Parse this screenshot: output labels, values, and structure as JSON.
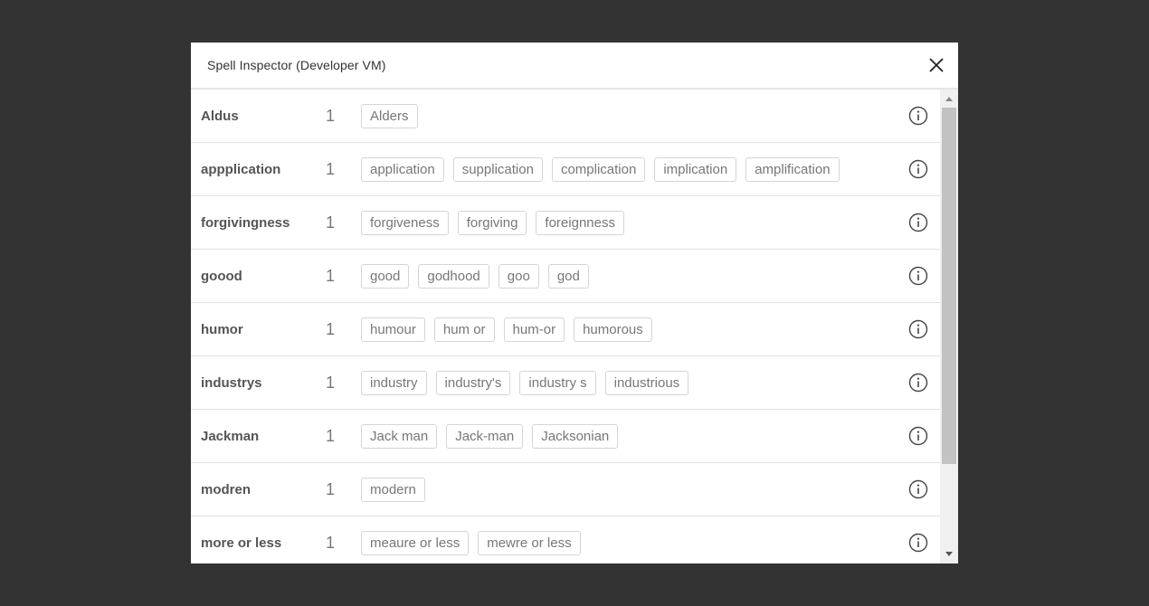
{
  "dialog": {
    "title": "Spell Inspector (Developer VM)"
  },
  "rows": [
    {
      "word": "Aldus",
      "count": "1",
      "suggestions": [
        "Alders"
      ]
    },
    {
      "word": "appplication",
      "count": "1",
      "suggestions": [
        "application",
        "supplication",
        "complication",
        "implication",
        "amplification"
      ]
    },
    {
      "word": "forgivingness",
      "count": "1",
      "suggestions": [
        "forgiveness",
        "forgiving",
        "foreignness"
      ]
    },
    {
      "word": "goood",
      "count": "1",
      "suggestions": [
        "good",
        "godhood",
        "goo",
        "god"
      ]
    },
    {
      "word": "humor",
      "count": "1",
      "suggestions": [
        "humour",
        "hum or",
        "hum-or",
        "humorous"
      ]
    },
    {
      "word": "industrys",
      "count": "1",
      "suggestions": [
        "industry",
        "industry's",
        "industry s",
        "industrious"
      ]
    },
    {
      "word": "Jackman",
      "count": "1",
      "suggestions": [
        "Jack man",
        "Jack-man",
        "Jacksonian"
      ]
    },
    {
      "word": "modren",
      "count": "1",
      "suggestions": [
        "modern"
      ]
    },
    {
      "word": "more or less",
      "count": "1",
      "suggestions": [
        "meaure or less",
        "mewre or less"
      ]
    }
  ],
  "icons": {
    "close": "close-icon",
    "info": "info-icon",
    "scroll_up": "scroll-up-arrow-icon",
    "scroll_down": "scroll-down-arrow-icon"
  },
  "colors": {
    "backdrop": "#333333",
    "dialog_bg": "#ffffff",
    "chip_border": "#d5d5d5",
    "text_muted": "#777777"
  }
}
